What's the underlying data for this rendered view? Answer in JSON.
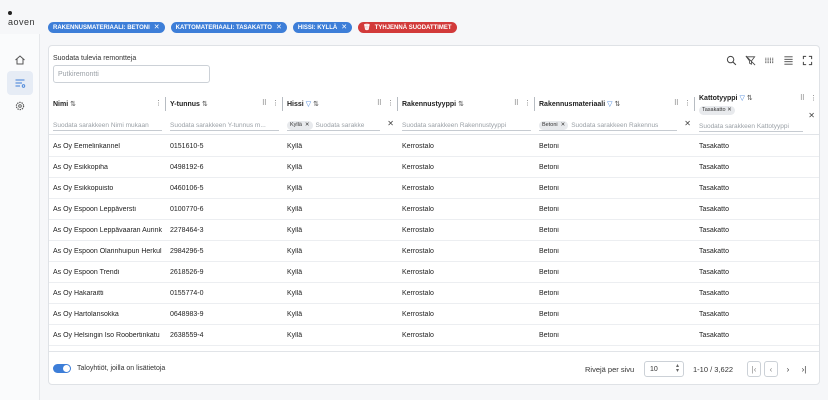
{
  "app": {
    "logo_text": "aoven"
  },
  "chips": [
    {
      "label": "RAKENNUSMATERIAALI: BETONI",
      "color": "blue"
    },
    {
      "label": "KATTOMATERIAALI: TASAKATTO",
      "color": "blue"
    },
    {
      "label": "HISSI: KYLLÄ",
      "color": "blue"
    },
    {
      "label": "TYHJENNÄ SUODATTIMET",
      "color": "red"
    }
  ],
  "toolbar": {
    "filter_label": "Suodata tulevia remontteja",
    "filter_placeholder": "Putkiremontti"
  },
  "columns": [
    {
      "key": "nimi",
      "title": "Nimi",
      "placeholder": "Suodata sarakkeen Nimi mukaan"
    },
    {
      "key": "ytunnus",
      "title": "Y-tunnus",
      "placeholder": "Suodata sarakkeen Y-tunnus m..."
    },
    {
      "key": "hissi",
      "title": "Hissi",
      "placeholder": "Suodata sarakke",
      "tag": "Kyllä"
    },
    {
      "key": "rakennustyyppi",
      "title": "Rakennustyyppi",
      "placeholder": "Suodata sarakkeen Rakennustyyppi"
    },
    {
      "key": "rakennusmateriaali",
      "title": "Rakennusmateriaali",
      "placeholder": "Suodata sarakkeen Rakennus",
      "tag": "Betoni"
    },
    {
      "key": "kattotyyppi",
      "title": "Kattotyyppi",
      "placeholder": "Suodata sarakkeen Kattotyyppi",
      "tag": "Tasakatto"
    }
  ],
  "rows": [
    [
      "As Oy Eemelinkannel",
      "0151610-5",
      "Kyllä",
      "Kerrostalo",
      "Betoni",
      "Tasakatto"
    ],
    [
      "As Oy Esikkopiha",
      "0498192-6",
      "Kyllä",
      "Kerrostalo",
      "Betoni",
      "Tasakatto"
    ],
    [
      "As Oy Esikkopuisto",
      "0460106-5",
      "Kyllä",
      "Kerrostalo",
      "Betoni",
      "Tasakatto"
    ],
    [
      "As Oy Espoon Leppäversti",
      "0100770-6",
      "Kyllä",
      "Kerrostalo",
      "Betoni",
      "Tasakatto"
    ],
    [
      "As Oy Espoon Leppävaaran Aurink",
      "2278464-3",
      "Kyllä",
      "Kerrostalo",
      "Betoni",
      "Tasakatto"
    ],
    [
      "As Oy Espoon Olarinhuipun Herkul",
      "2984296-5",
      "Kyllä",
      "Kerrostalo",
      "Betoni",
      "Tasakatto"
    ],
    [
      "As Oy Espoon Trendi",
      "2618526-9",
      "Kyllä",
      "Kerrostalo",
      "Betoni",
      "Tasakatto"
    ],
    [
      "As Oy Hakaraitti",
      "0155774-0",
      "Kyllä",
      "Kerrostalo",
      "Betoni",
      "Tasakatto"
    ],
    [
      "As Oy Hartolansokka",
      "0648983-9",
      "Kyllä",
      "Kerrostalo",
      "Betoni",
      "Tasakatto"
    ],
    [
      "As Oy Helsingin Iso Roobertinkatu",
      "2638559-4",
      "Kyllä",
      "Kerrostalo",
      "Betoni",
      "Tasakatto"
    ]
  ],
  "footer": {
    "toggle_label": "Taloyhtiöt, joilla on lisätietoja",
    "rows_per_page_label": "Rivejä per sivu",
    "rows_per_page_value": "10",
    "range_text": "1-10 / 3,622"
  },
  "colors": {
    "accent": "#3d7ed8",
    "danger": "#d23a3a"
  }
}
